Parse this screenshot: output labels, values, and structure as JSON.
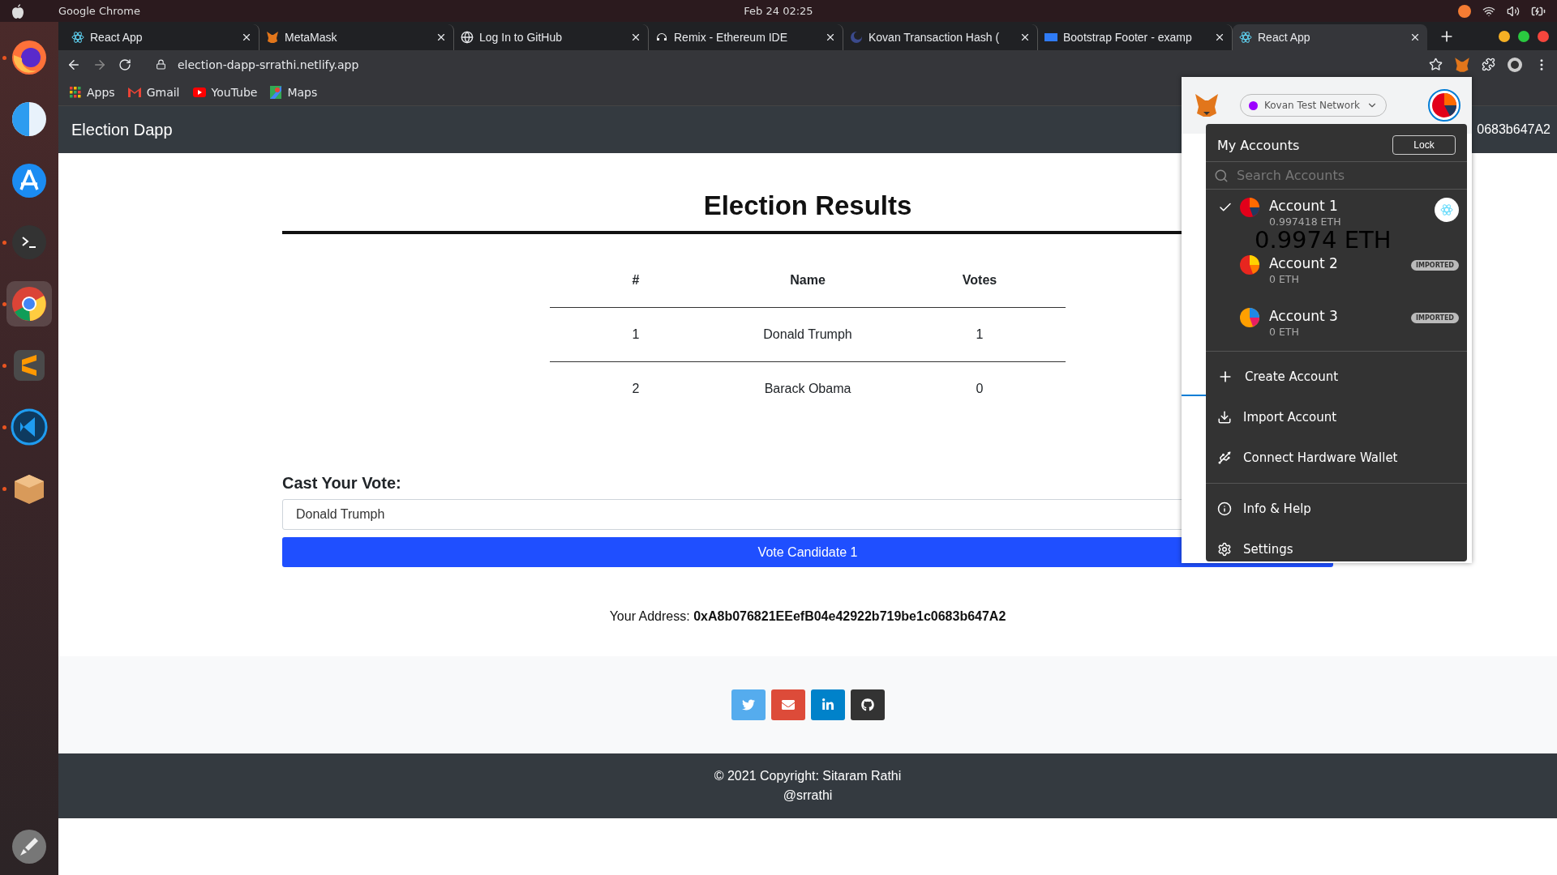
{
  "top_bar": {
    "app_name": "Google Chrome",
    "clock": "Feb 24  02:25"
  },
  "dock": [
    {
      "kind": "firefox",
      "selected": false,
      "running": true
    },
    {
      "kind": "finder",
      "selected": false,
      "running": false
    },
    {
      "kind": "store",
      "selected": false,
      "running": false
    },
    {
      "kind": "terminal",
      "selected": false,
      "running": true
    },
    {
      "kind": "chrome",
      "selected": true,
      "running": true
    },
    {
      "kind": "sublime",
      "selected": false,
      "running": true
    },
    {
      "kind": "vscode",
      "selected": false,
      "running": true
    },
    {
      "kind": "box",
      "selected": false,
      "running": true
    }
  ],
  "tabs": [
    {
      "title": "React App",
      "selected": false
    },
    {
      "title": "MetaMask",
      "selected": false
    },
    {
      "title": "Log In to GitHub",
      "selected": false
    },
    {
      "title": "Remix - Ethereum IDE",
      "selected": false
    },
    {
      "title": "Kovan Transaction Hash (",
      "selected": false
    },
    {
      "title": "Bootstrap Footer - examp",
      "selected": false
    },
    {
      "title": "React App",
      "selected": true
    }
  ],
  "address_bar": {
    "url": "election-dapp-srrathi.netlify.app"
  },
  "bookmarks": [
    {
      "label": "Apps"
    },
    {
      "label": "Gmail"
    },
    {
      "label": "YouTube"
    },
    {
      "label": "Maps"
    }
  ],
  "navbar": {
    "brand": "Election Dapp",
    "address_fragment": "0683b647A2"
  },
  "results": {
    "title": "Election Results",
    "columns": [
      "#",
      "Name",
      "Votes"
    ],
    "rows": [
      [
        "1",
        "Donald Trumph",
        "1"
      ],
      [
        "2",
        "Barack Obama",
        "0"
      ]
    ]
  },
  "vote_form": {
    "label": "Cast Your Vote:",
    "value": "Donald Trumph",
    "button": "Vote Candidate 1"
  },
  "address": {
    "label": "Your Address:",
    "value": "0xA8b076821EEefB04e42922b719be1c0683b647A2"
  },
  "social": [
    {
      "kind": "twitter",
      "color": "#55acee"
    },
    {
      "kind": "email",
      "color": "#dd4b39"
    },
    {
      "kind": "linkedin",
      "color": "#0082ca"
    },
    {
      "kind": "github",
      "color": "#333333"
    }
  ],
  "footer": {
    "copyright": "© 2021 Copyright: Sitaram Rathi",
    "handle": "@srrathi"
  },
  "metamask": {
    "network": "Kovan Test Network",
    "menu_title": "My Accounts",
    "lock": "Lock",
    "search_placeholder": "Search Accounts",
    "balance_behind": "0.9974 ETH",
    "accounts": [
      {
        "name": "Account 1",
        "balance": "0.997418 ETH",
        "selected": true
      },
      {
        "name": "Account 2",
        "balance": "0 ETH",
        "selected": false,
        "badge": "IMPORTED"
      },
      {
        "name": "Account 3",
        "balance": "0 ETH",
        "selected": false,
        "badge": "IMPORTED"
      }
    ],
    "actions": [
      {
        "label": "Create Account"
      },
      {
        "label": "Import Account"
      },
      {
        "label": "Connect Hardware Wallet"
      }
    ],
    "links": [
      {
        "label": "Info & Help"
      },
      {
        "label": "Settings"
      }
    ]
  }
}
